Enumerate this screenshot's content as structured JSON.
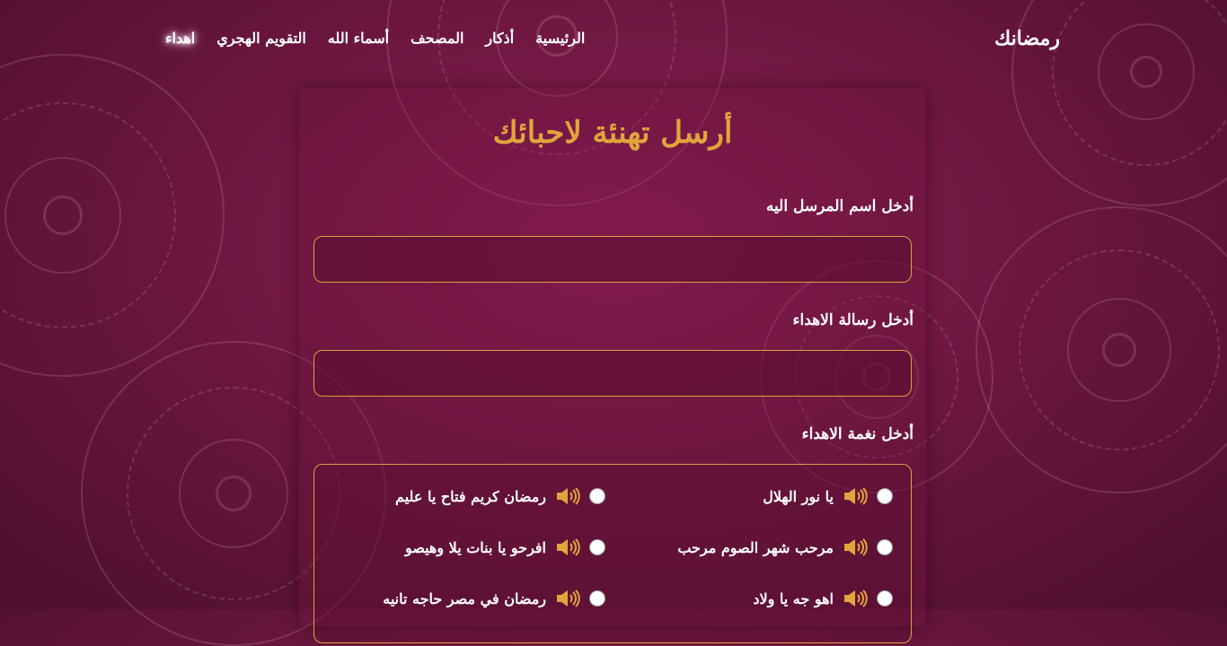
{
  "brand": "رمضانك",
  "nav": {
    "items": [
      {
        "label": "الرئيسية",
        "active": false
      },
      {
        "label": "أذكار",
        "active": false
      },
      {
        "label": "المصحف",
        "active": false
      },
      {
        "label": "أسماء الله",
        "active": false
      },
      {
        "label": "التقويم الهجري",
        "active": false
      },
      {
        "label": "اهداء",
        "active": true
      }
    ]
  },
  "form": {
    "title": "أرسل تهنئة لاحبائك",
    "recipient_label": "أدخل اسم المرسل اليه",
    "recipient_value": "",
    "message_label": "أدخل رسالة الاهداء",
    "message_value": "",
    "tone_label": "أدخل نغمة الاهداء",
    "tones": [
      {
        "label": "يا نور الهلال",
        "selected": false,
        "icon": "speaker-icon"
      },
      {
        "label": "رمضان كريم فتاح يا عليم",
        "selected": false,
        "icon": "speaker-icon"
      },
      {
        "label": "مرحب شهر الصوم مرحب",
        "selected": false,
        "icon": "speaker-icon"
      },
      {
        "label": "افرحو يا بنات يلا وهيصو",
        "selected": false,
        "icon": "speaker-icon"
      },
      {
        "label": "اهو جه يا ولاد",
        "selected": false,
        "icon": "speaker-icon"
      },
      {
        "label": "رمضان في مصر حاجه تانيه",
        "selected": false,
        "icon": "speaker-icon"
      }
    ]
  },
  "colors": {
    "accent": "#e0a53c",
    "background": "#7a1a48",
    "speaker": "#e0a53c"
  }
}
